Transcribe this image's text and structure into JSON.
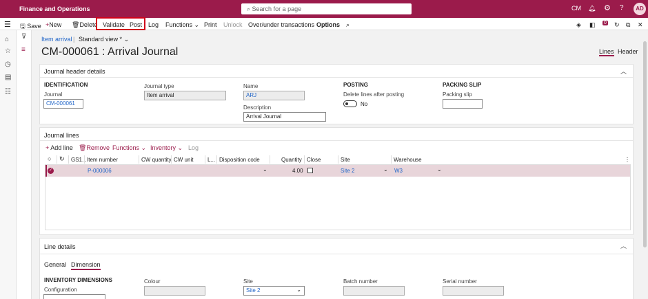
{
  "app": {
    "title": "Finance and Operations",
    "search_placeholder": "Search for a page",
    "company": "CM",
    "user_initials": "AD"
  },
  "actions": {
    "save": "Save",
    "new": "New",
    "delete": "Delete",
    "validate": "Validate",
    "post": "Post",
    "log": "Log",
    "functions": "Functions",
    "print": "Print",
    "unlock": "Unlock",
    "over_under": "Over/under transactions",
    "options": "Options",
    "badge": "0"
  },
  "page": {
    "breadcrumb": "Item arrival",
    "view": "Standard view *",
    "title": "CM-000061 : Arrival Journal",
    "tab_lines": "Lines",
    "tab_header": "Header"
  },
  "header_section": {
    "title": "Journal header details",
    "identification": {
      "group": "IDENTIFICATION",
      "journal_label": "Journal",
      "journal_value": "CM-000061"
    },
    "journal_type": {
      "label": "Journal type",
      "value": "Item arrival"
    },
    "name": {
      "label": "Name",
      "value": "ARJ"
    },
    "description": {
      "label": "Description",
      "value": "Arrival Journal"
    },
    "posting": {
      "group": "POSTING",
      "label": "Delete lines after posting",
      "value": "No"
    },
    "packing": {
      "group": "PACKING SLIP",
      "label": "Packing slip",
      "value": ""
    }
  },
  "lines_section": {
    "title": "Journal lines",
    "buttons": {
      "add_line": "Add line",
      "remove": "Remove",
      "functions": "Functions",
      "inventory": "Inventory",
      "log": "Log"
    },
    "columns": [
      "GS1...",
      "Item number",
      "CW quantity",
      "CW unit",
      "L...",
      "Disposition code",
      "Quantity",
      "Close",
      "Site",
      "Warehouse"
    ],
    "rows": [
      {
        "item_number": "P-000006",
        "cw_quantity": "",
        "cw_unit": "",
        "disposition_code": "",
        "quantity": "4.00",
        "close": false,
        "site": "Site 2",
        "warehouse": "W3"
      }
    ]
  },
  "line_details": {
    "title": "Line details",
    "tabs": [
      "General",
      "Dimension"
    ],
    "active_tab": "Dimension",
    "inventory_dimensions": "INVENTORY DIMENSIONS",
    "configuration_label": "Configuration",
    "colour_label": "Colour",
    "site_label": "Site",
    "site_value": "Site 2",
    "batch_label": "Batch number",
    "serial_label": "Serial number"
  },
  "colors": {
    "brand": "#9b1b4b",
    "link": "#2266c8",
    "highlight": "#d0021b",
    "selected_row": "#e8d5da"
  }
}
